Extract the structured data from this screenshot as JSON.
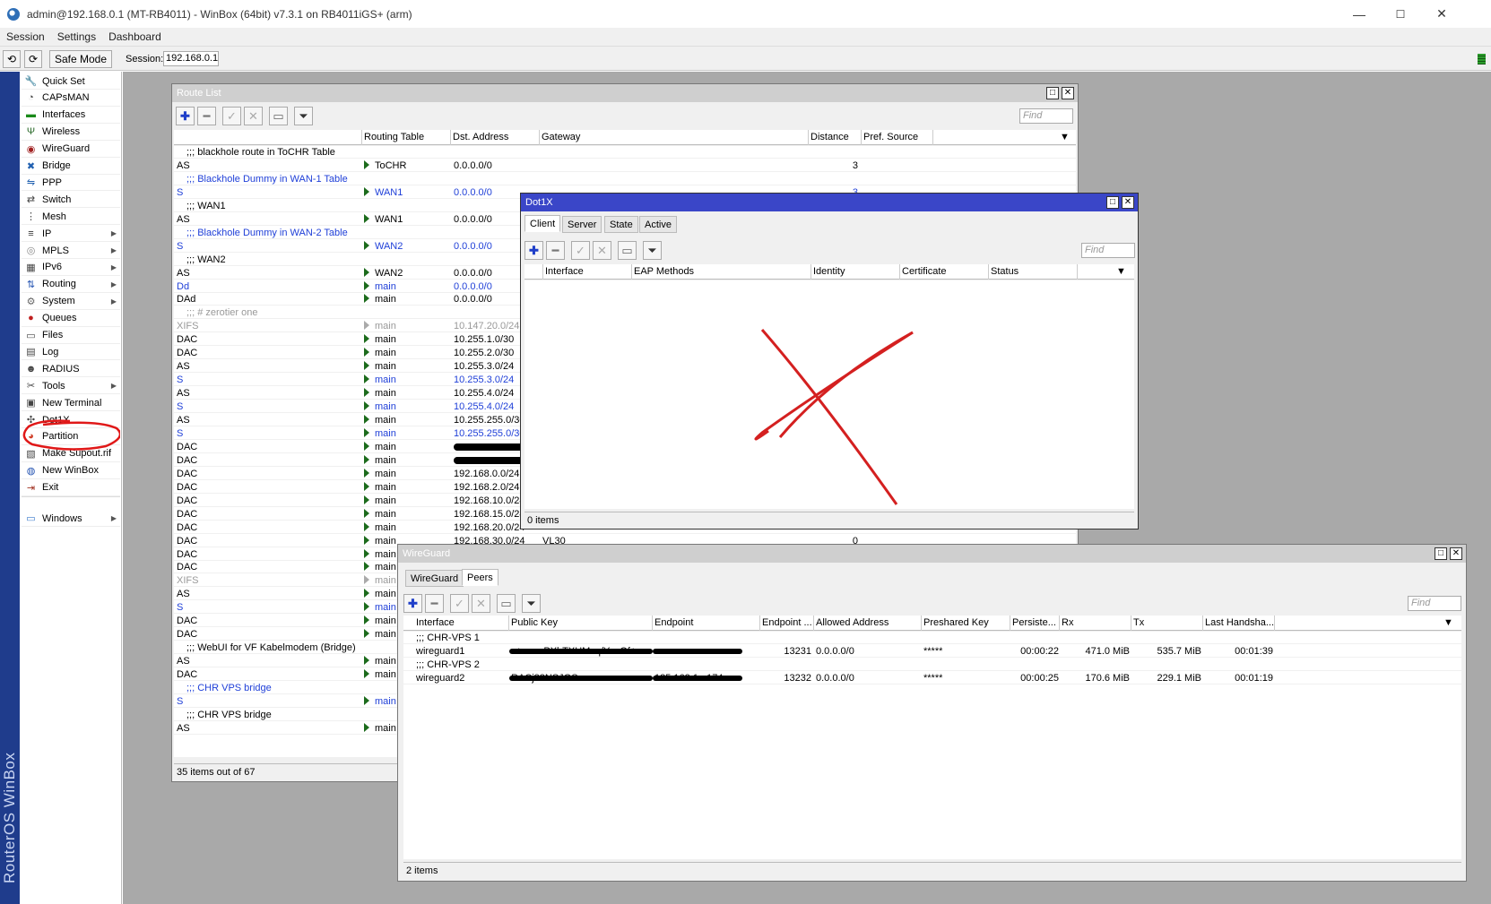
{
  "app": {
    "title": "admin@192.168.0.1 (MT-RB4011) - WinBox (64bit) v7.3.1 on RB4011iGS+ (arm)",
    "window_controls": [
      "—",
      "☐",
      "✕"
    ]
  },
  "menubar": [
    "Session",
    "Settings",
    "Dashboard"
  ],
  "toolbar": {
    "undo": "⟲",
    "redo": "⟳",
    "safe_mode": "Safe Mode",
    "session_label": "Session:",
    "session_value": "192.168.0.1"
  },
  "brand": "RouterOS WinBox",
  "sidebar": [
    {
      "label": "Quick Set",
      "icon": "wrench-icon",
      "arrow": false
    },
    {
      "label": "CAPsMAN",
      "icon": "capsman-icon",
      "arrow": false
    },
    {
      "label": "Interfaces",
      "icon": "interfaces-icon",
      "arrow": false
    },
    {
      "label": "Wireless",
      "icon": "wireless-icon",
      "arrow": false
    },
    {
      "label": "WireGuard",
      "icon": "wireguard-icon",
      "arrow": false
    },
    {
      "label": "Bridge",
      "icon": "bridge-icon",
      "arrow": false
    },
    {
      "label": "PPP",
      "icon": "ppp-icon",
      "arrow": false
    },
    {
      "label": "Switch",
      "icon": "switch-icon",
      "arrow": false
    },
    {
      "label": "Mesh",
      "icon": "mesh-icon",
      "arrow": false
    },
    {
      "label": "IP",
      "icon": "ip-icon",
      "arrow": true
    },
    {
      "label": "MPLS",
      "icon": "mpls-icon",
      "arrow": true
    },
    {
      "label": "IPv6",
      "icon": "ipv6-icon",
      "arrow": true
    },
    {
      "label": "Routing",
      "icon": "routing-icon",
      "arrow": true
    },
    {
      "label": "System",
      "icon": "gear-icon",
      "arrow": true
    },
    {
      "label": "Queues",
      "icon": "queues-icon",
      "arrow": false
    },
    {
      "label": "Files",
      "icon": "folder-icon",
      "arrow": false
    },
    {
      "label": "Log",
      "icon": "log-icon",
      "arrow": false
    },
    {
      "label": "RADIUS",
      "icon": "radius-icon",
      "arrow": false
    },
    {
      "label": "Tools",
      "icon": "tools-icon",
      "arrow": true
    },
    {
      "label": "New Terminal",
      "icon": "terminal-icon",
      "arrow": false
    },
    {
      "label": "Dot1X",
      "icon": "dot1x-icon",
      "arrow": false
    },
    {
      "label": "Partition",
      "icon": "partition-icon",
      "arrow": false
    },
    {
      "label": "Make Supout.rif",
      "icon": "supout-icon",
      "arrow": false
    },
    {
      "label": "New WinBox",
      "icon": "winbox-icon",
      "arrow": false
    },
    {
      "label": "Exit",
      "icon": "exit-icon",
      "arrow": false
    },
    {
      "label": "Windows",
      "icon": "windows-icon",
      "arrow": true
    }
  ],
  "route_list": {
    "title": "Route List",
    "find_placeholder": "Find",
    "columns": [
      "",
      "Routing Table",
      "Dst. Address",
      "Gateway",
      "Distance",
      "Pref. Source"
    ],
    "rows": [
      {
        "kind": "comment",
        "text": ";;; blackhole route in ToCHR Table",
        "style": ""
      },
      {
        "flags": "AS",
        "table": "ToCHR",
        "dst": "0.0.0.0/0",
        "gw": "",
        "dist": "3",
        "style": ""
      },
      {
        "kind": "comment",
        "text": ";;; Blackhole Dummy in WAN-1 Table",
        "style": "blue"
      },
      {
        "flags": "S",
        "table": "WAN1",
        "dst": "0.0.0.0/0",
        "gw": "",
        "dist": "3",
        "style": "blue"
      },
      {
        "kind": "comment",
        "text": ";;; WAN1",
        "style": ""
      },
      {
        "flags": "AS",
        "table": "WAN1",
        "dst": "0.0.0.0/0",
        "gw": "",
        "dist": "",
        "style": ""
      },
      {
        "kind": "comment",
        "text": ";;; Blackhole Dummy in WAN-2 Table",
        "style": "blue"
      },
      {
        "flags": "S",
        "table": "WAN2",
        "dst": "0.0.0.0/0",
        "gw": "",
        "dist": "",
        "style": "blue"
      },
      {
        "kind": "comment",
        "text": ";;; WAN2",
        "style": ""
      },
      {
        "flags": "AS",
        "table": "WAN2",
        "dst": "0.0.0.0/0",
        "gw": "",
        "dist": "",
        "style": ""
      },
      {
        "flags": "Dd",
        "table": "main",
        "dst": "0.0.0.0/0",
        "gw": "",
        "dist": "",
        "style": "blue"
      },
      {
        "flags": "DAd",
        "table": "main",
        "dst": "0.0.0.0/0",
        "gw": "",
        "dist": "",
        "style": ""
      },
      {
        "kind": "comment",
        "text": ";;; # zerotier one",
        "style": "gray"
      },
      {
        "flags": "XIFS",
        "table": "main",
        "dst": "10.147.20.0/24",
        "gw": "",
        "dist": "",
        "style": "gray"
      },
      {
        "flags": "DAC",
        "table": "main",
        "dst": "10.255.1.0/30",
        "gw": "",
        "dist": "",
        "style": ""
      },
      {
        "flags": "DAC",
        "table": "main",
        "dst": "10.255.2.0/30",
        "gw": "",
        "dist": "",
        "style": ""
      },
      {
        "flags": "AS",
        "table": "main",
        "dst": "10.255.3.0/24",
        "gw": "",
        "dist": "",
        "style": ""
      },
      {
        "flags": "S",
        "table": "main",
        "dst": "10.255.3.0/24",
        "gw": "",
        "dist": "",
        "style": "blue"
      },
      {
        "flags": "AS",
        "table": "main",
        "dst": "10.255.4.0/24",
        "gw": "",
        "dist": "",
        "style": ""
      },
      {
        "flags": "S",
        "table": "main",
        "dst": "10.255.4.0/24",
        "gw": "",
        "dist": "",
        "style": "blue"
      },
      {
        "flags": "AS",
        "table": "main",
        "dst": "10.255.255.0/30",
        "gw": "",
        "dist": "",
        "style": ""
      },
      {
        "flags": "S",
        "table": "main",
        "dst": "10.255.255.0/30",
        "gw": "",
        "dist": "",
        "style": "blue"
      },
      {
        "flags": "DAC",
        "table": "main",
        "dst": "",
        "gw": "",
        "dist": "",
        "style": "",
        "redacted": true
      },
      {
        "flags": "DAC",
        "table": "main",
        "dst": "",
        "gw": "",
        "dist": "",
        "style": "",
        "redacted": true
      },
      {
        "flags": "DAC",
        "table": "main",
        "dst": "192.168.0.0/24",
        "gw": "",
        "dist": "",
        "style": ""
      },
      {
        "flags": "DAC",
        "table": "main",
        "dst": "192.168.2.0/24",
        "gw": "",
        "dist": "",
        "style": ""
      },
      {
        "flags": "DAC",
        "table": "main",
        "dst": "192.168.10.0/24",
        "gw": "",
        "dist": "",
        "style": ""
      },
      {
        "flags": "DAC",
        "table": "main",
        "dst": "192.168.15.0/24",
        "gw": "",
        "dist": "",
        "style": ""
      },
      {
        "flags": "DAC",
        "table": "main",
        "dst": "192.168.20.0/24",
        "gw": "",
        "dist": "",
        "style": ""
      },
      {
        "flags": "DAC",
        "table": "main",
        "dst": "192.168.30.0/24",
        "gw": "VL30",
        "dist": "0",
        "style": ""
      },
      {
        "flags": "DAC",
        "table": "main",
        "dst": "",
        "gw": "",
        "dist": "",
        "style": ""
      },
      {
        "flags": "DAC",
        "table": "main",
        "dst": "",
        "gw": "",
        "dist": "",
        "style": ""
      },
      {
        "flags": "XIFS",
        "table": "main",
        "dst": "",
        "gw": "",
        "dist": "",
        "style": "gray"
      },
      {
        "flags": "AS",
        "table": "main",
        "dst": "",
        "gw": "",
        "dist": "",
        "style": ""
      },
      {
        "flags": "S",
        "table": "main",
        "dst": "",
        "gw": "",
        "dist": "",
        "style": "blue"
      },
      {
        "flags": "DAC",
        "table": "main",
        "dst": "",
        "gw": "",
        "dist": "",
        "style": ""
      },
      {
        "flags": "DAC",
        "table": "main",
        "dst": "",
        "gw": "",
        "dist": "",
        "style": ""
      },
      {
        "kind": "comment",
        "text": ";;; WebUI for VF Kabelmodem (Bridge)",
        "style": ""
      },
      {
        "flags": "AS",
        "table": "main",
        "dst": "",
        "gw": "",
        "dist": "",
        "style": ""
      },
      {
        "flags": "DAC",
        "table": "main",
        "dst": "",
        "gw": "",
        "dist": "",
        "style": ""
      },
      {
        "kind": "comment",
        "text": ";;; CHR VPS bridge",
        "style": "blue"
      },
      {
        "flags": "S",
        "table": "main",
        "dst": "",
        "gw": "",
        "dist": "",
        "style": "blue"
      },
      {
        "kind": "comment",
        "text": ";;; CHR VPS bridge",
        "style": ""
      },
      {
        "flags": "AS",
        "table": "main",
        "dst": "",
        "gw": "",
        "dist": "",
        "style": ""
      }
    ],
    "status": "35 items out of 67"
  },
  "dot1x": {
    "title": "Dot1X",
    "tabs": [
      "Client",
      "Server",
      "State",
      "Active"
    ],
    "find_placeholder": "Find",
    "columns": [
      "",
      "Interface",
      "EAP Methods",
      "Identity",
      "Certificate",
      "Status"
    ],
    "status": "0 items",
    "overlay_color": "#d42020"
  },
  "wireguard": {
    "title": "WireGuard",
    "tabs": [
      "WireGuard",
      "Peers"
    ],
    "find_placeholder": "Find",
    "columns": [
      "Interface",
      "Public Key",
      "Endpoint",
      "Endpoint ...",
      "Allowed Address",
      "Preshared Key",
      "Persiste...",
      "Rx",
      "Tx",
      "Last Handsha..."
    ],
    "rows": [
      {
        "kind": "comment",
        "text": ";;; CHR-VPS 1"
      },
      {
        "iface": "wireguard1",
        "pubkey": "s+r...eePXhTXHMzq/YcvOf+...",
        "endpoint": "",
        "port": "13231",
        "allowed": "0.0.0.0/0",
        "psk": "*****",
        "persist": "00:00:22",
        "rx": "471.0 MiB",
        "tx": "535.7 MiB",
        "hs": "00:01:39"
      },
      {
        "kind": "comment",
        "text": ";;; CHR-VPS 2"
      },
      {
        "iface": "wireguard2",
        "pubkey": "RACj83NSJGSv...",
        "endpoint": "185.162.1...174",
        "port": "13232",
        "allowed": "0.0.0.0/0",
        "psk": "*****",
        "persist": "00:00:25",
        "rx": "170.6 MiB",
        "tx": "229.1 MiB",
        "hs": "00:01:19"
      }
    ],
    "status": "2 items"
  },
  "annotation_color": "#e01818"
}
